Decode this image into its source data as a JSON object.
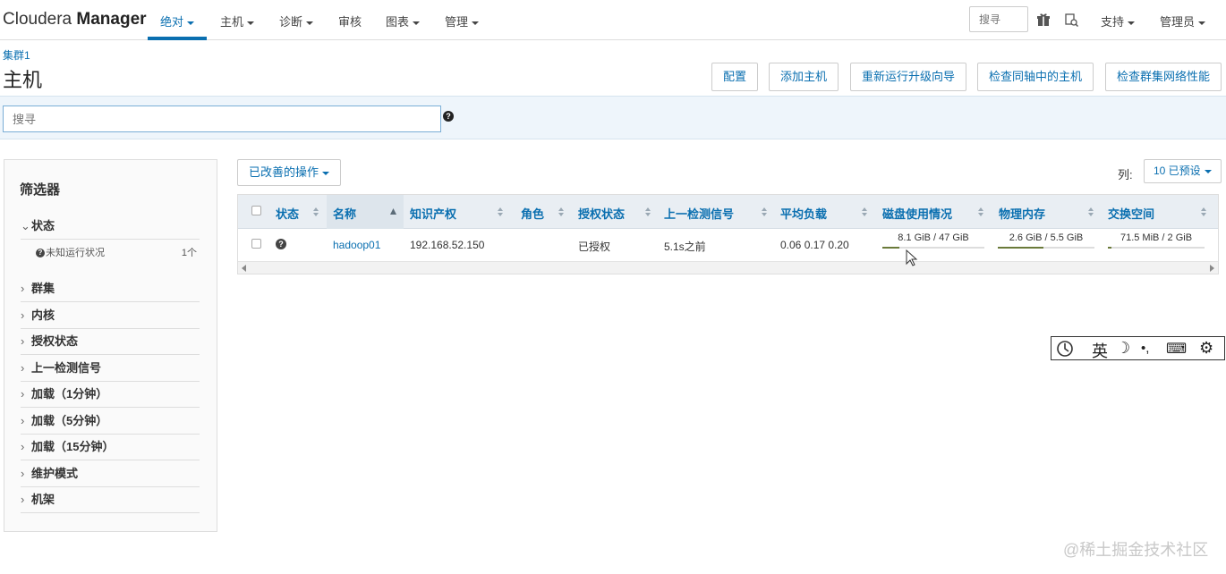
{
  "brand": {
    "name": "Cloudera",
    "name_bold": "Manager"
  },
  "nav": {
    "items": [
      {
        "label": "绝对"
      },
      {
        "label": "主机"
      },
      {
        "label": "诊断"
      },
      {
        "label": "审核"
      },
      {
        "label": "图表"
      },
      {
        "label": "管理"
      }
    ],
    "search_placeholder": "搜寻",
    "support": "支持",
    "admin": "管理员"
  },
  "breadcrumb": "集群1",
  "page_title": "主机",
  "actions": {
    "configure": "配置",
    "add_host": "添加主机",
    "rerun_upgrade": "重新运行升级向导",
    "inspect_hosts": "检查同轴中的主机",
    "inspect_network": "检查群集网络性能"
  },
  "search": {
    "placeholder": "搜寻",
    "help": "?"
  },
  "filters": {
    "title": "筛选器",
    "groups": [
      "状态",
      "群集",
      "内核",
      "授权状态",
      "上一检测信号",
      "加载（1分钟）",
      "加载（5分钟）",
      "加载（15分钟）",
      "维护模式",
      "机架"
    ],
    "status_sub": {
      "label": "未知运行状况",
      "count": "1个"
    }
  },
  "toolbar": {
    "ops_label": "已改善的操作",
    "columns_label": "列:",
    "columns_value": "10 已预设"
  },
  "table": {
    "headers": [
      "状态",
      "名称",
      "知识产权",
      "角色",
      "授权状态",
      "上一检测信号",
      "平均负载",
      "磁盘使用情况",
      "物理内存",
      "交换空间"
    ],
    "rows": [
      {
        "name": "hadoop01",
        "ip": "192.168.52.150",
        "role": "",
        "auth": "已授权",
        "heartbeat": "5.1s之前",
        "load": "0.06 0.17 0.20",
        "disk": "8.1 GiB / 47 GiB",
        "disk_pct": 17,
        "memory": "2.6 GiB / 5.5 GiB",
        "memory_pct": 47,
        "swap": "71.5 MiB / 2 GiB",
        "swap_pct": 4
      }
    ]
  },
  "ime": {
    "mode": "英"
  },
  "watermark": "@稀土掘金技术社区",
  "colors": {
    "link": "#0a6fb0",
    "header_bg": "#e9eef3",
    "search_band": "#eef5fb"
  }
}
